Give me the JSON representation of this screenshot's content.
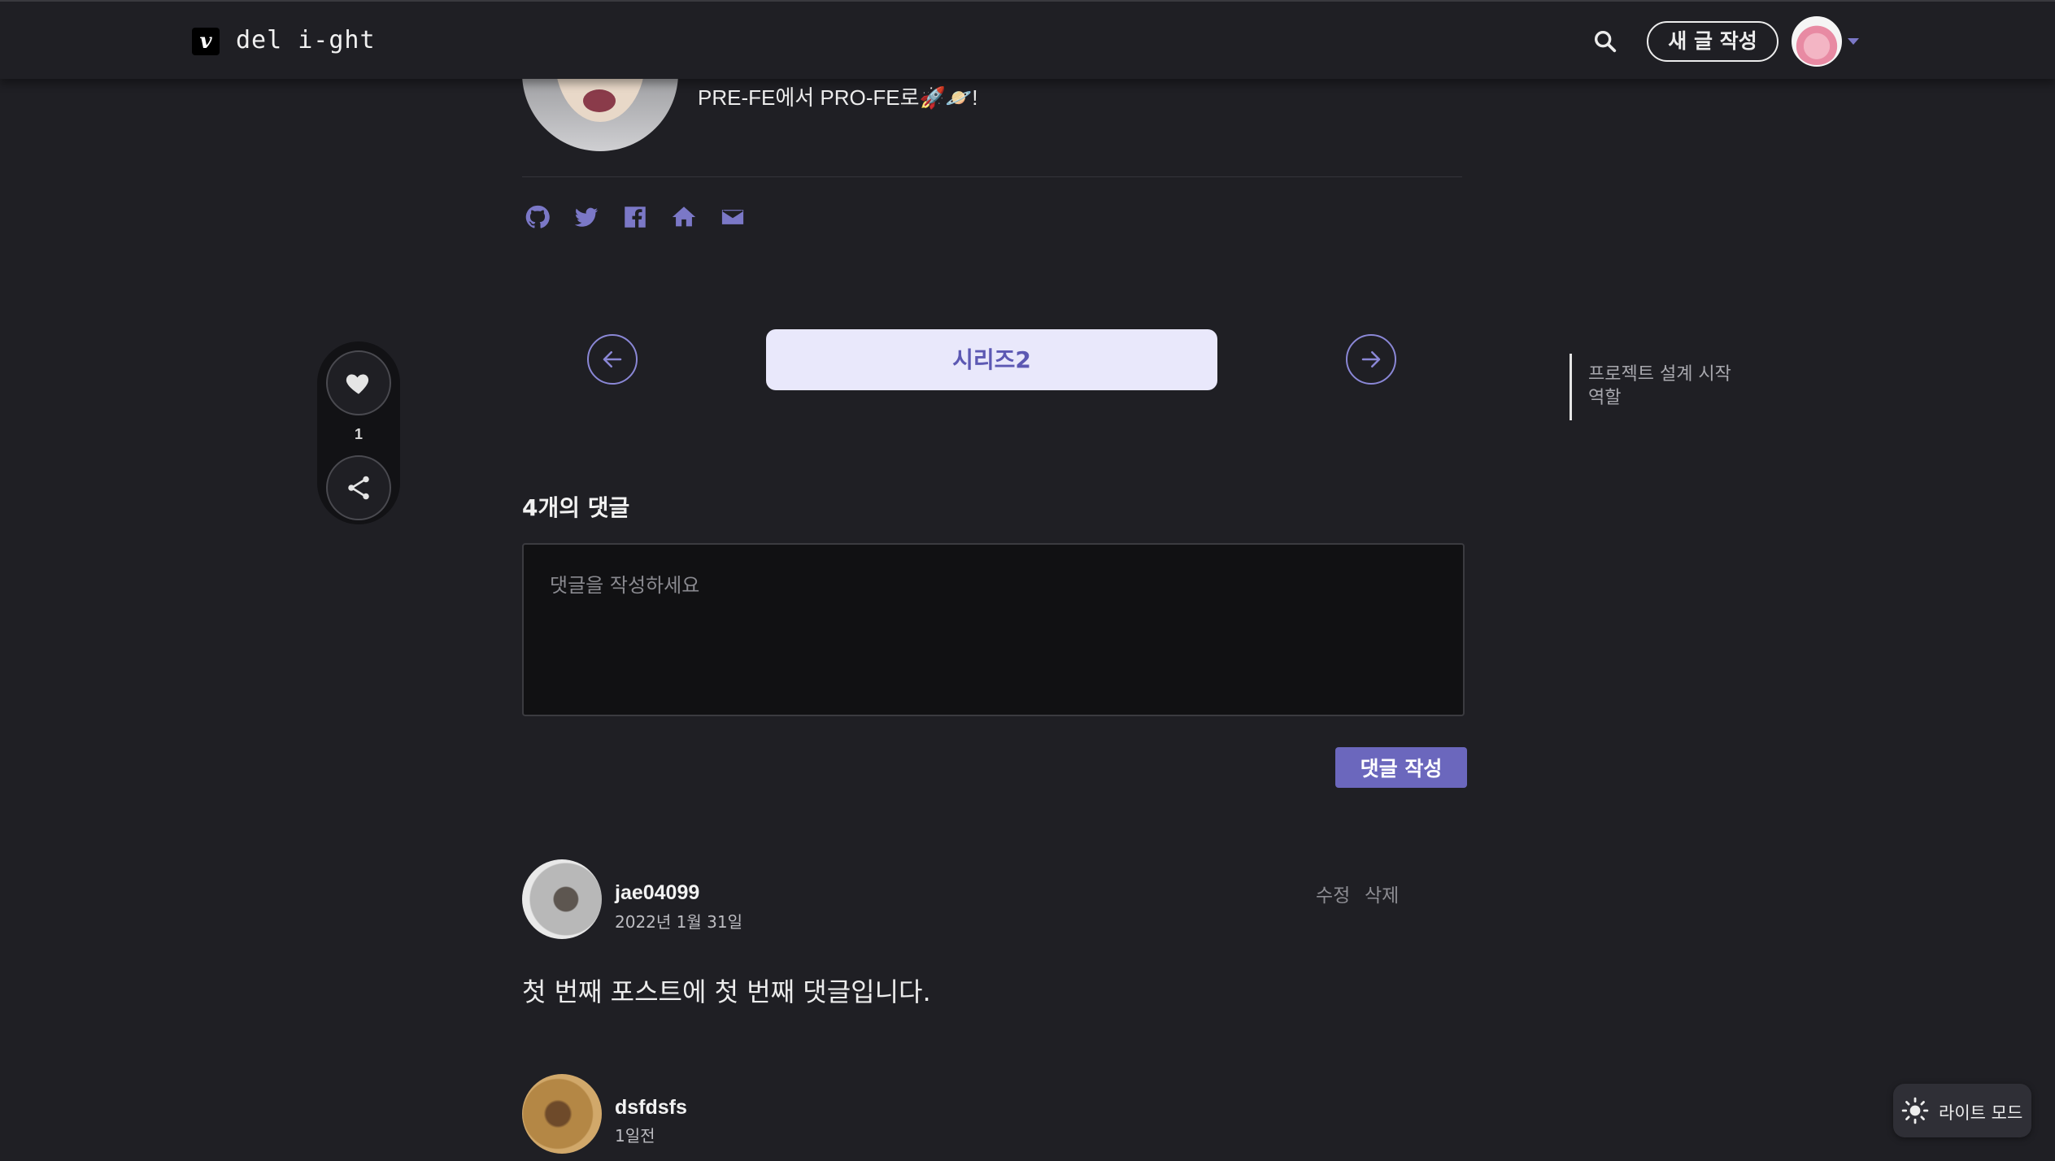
{
  "header": {
    "logo_letter": "v",
    "blog_name": "del i-ght",
    "new_post_label": "새 글 작성"
  },
  "profile": {
    "bio": "PRE-FE에서 PRO-FE로🚀🪐!"
  },
  "social_icons": [
    "github-icon",
    "twitter-icon",
    "facebook-icon",
    "home-icon",
    "email-icon"
  ],
  "series": {
    "title": "시리즈2"
  },
  "like_bar": {
    "count": "1"
  },
  "toc": {
    "items": [
      "프로젝트 설계 시작",
      "역할"
    ]
  },
  "comments": {
    "count_label": "4개의 댓글",
    "placeholder": "댓글을 작성하세요",
    "submit_label": "댓글 작성",
    "list": [
      {
        "user": "jae04099",
        "date": "2022년 1월 31일",
        "edit_label": "수정",
        "delete_label": "삭제",
        "text": "첫 번째 포스트에 첫 번째 댓글입니다."
      },
      {
        "user": "dsfdsfs",
        "date": "1일전"
      }
    ]
  },
  "theme_toggle": {
    "label": "라이트 모드"
  },
  "colors": {
    "background": "#1f1f24",
    "accent": "#6b67bd",
    "series_pill_bg": "#e9e8fb"
  }
}
